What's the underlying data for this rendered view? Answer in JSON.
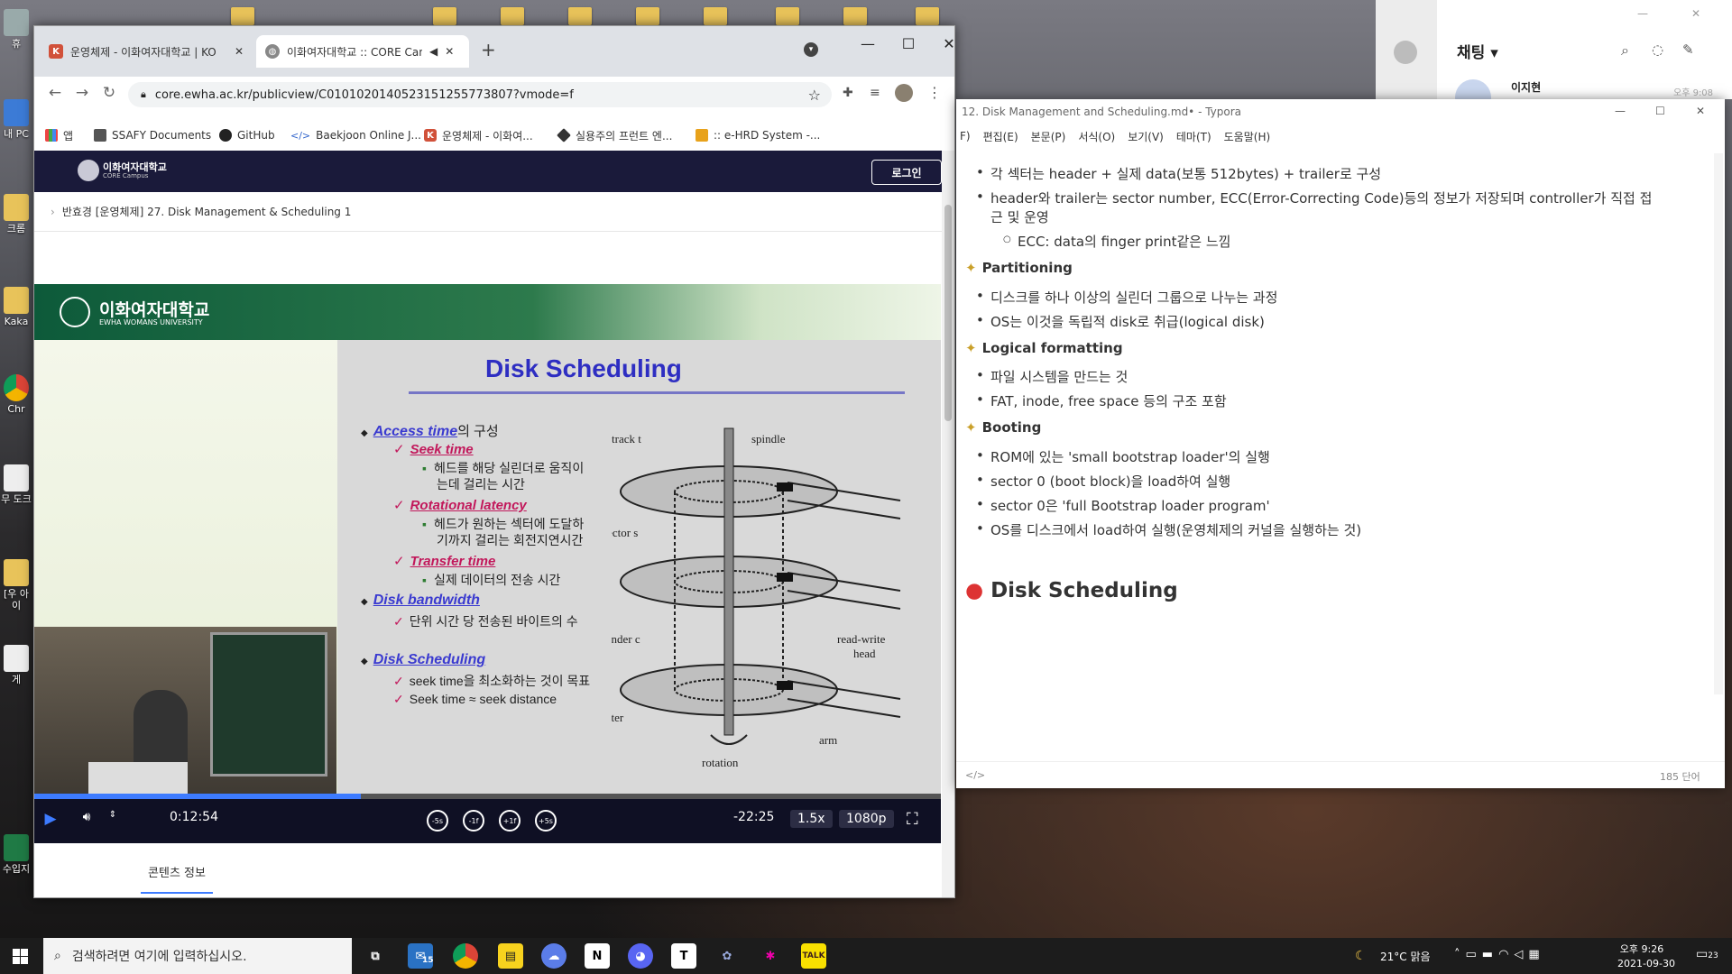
{
  "desktop": {
    "icons": [
      "휴",
      "내 PC",
      "크롬",
      "Kaka",
      "Chr",
      "무\n도크",
      "[우\n아이",
      "게",
      "수입지"
    ]
  },
  "chrome": {
    "tabs": [
      {
        "label": "운영체제 - 이화여자대학교 | KO"
      },
      {
        "label": "이화여자대학교 :: CORE Can"
      }
    ],
    "new_tab": "+",
    "url": "core.ewha.ac.kr/publicview/C0101020140523151255773807?vmode=f",
    "bookmarks": [
      "앱",
      "SSAFY Documents",
      "GitHub",
      "Baekjoon Online J...",
      "운영체제 - 이화여...",
      "실용주의 프런트 엔...",
      ":: e-HRD System -..."
    ],
    "site": {
      "brand": "이화여자대학교",
      "brand_sub": "CORE Campus",
      "login": "로그인",
      "breadcrumb": "반효경 [운영체제] 27. Disk Management & Scheduling 1",
      "content_tab": "콘텐츠 정보"
    },
    "player": {
      "time": "0:12:54",
      "remaining": "-22:25",
      "speed": "1.5x",
      "quality": "1080p",
      "progress": 0.36,
      "skips": [
        "-5s",
        "-1f",
        "+1f",
        "+5s"
      ]
    },
    "slide": {
      "univ": "이화여자대학교",
      "univ_en": "EWHA WOMANS UNIVERSITY",
      "title": "Disk Scheduling",
      "access_time": "Access time",
      "access_suffix": "의 구성",
      "seek": "Seek time",
      "seek_desc1": "헤드를 해당 실린더로 움직이",
      "seek_desc2": "는데 걸리는 시간",
      "rot": "Rotational latency",
      "rot_desc1": "헤드가 원하는 섹터에 도달하",
      "rot_desc2": "기까지 걸리는 회전지연시간",
      "transfer": "Transfer time",
      "transfer_desc": "실제 데이터의 전송 시간",
      "bandwidth": "Disk bandwidth",
      "bandwidth_desc": "단위 시간 당 전송된 바이트의 수",
      "sched": "Disk Scheduling",
      "sched_desc1": "seek time을 최소화하는 것이 목표",
      "sched_desc2": "Seek time ≈ seek distance",
      "diagram": {
        "track": "track t",
        "spindle": "spindle",
        "sector": "sector s",
        "cylinder": "cylinder c",
        "rw": "read-write",
        "head": "head",
        "platter": "platter",
        "arm": "arm",
        "rotation": "rotation"
      }
    }
  },
  "typora": {
    "title": "12. Disk Management and Scheduling.md• - Typora",
    "menu": [
      "F)",
      "편집(E)",
      "본문(P)",
      "서식(O)",
      "보기(V)",
      "테마(T)",
      "도움말(H)"
    ],
    "lines": {
      "l1": "각 섹터는 header + 실제 data(보통 512bytes) + trailer로 구성",
      "l2a": "header와 trailer는 sector number, ECC(Error-Correcting Code)등의 정보가 저장되며 controller가 직접 접",
      "l2b": "근 및 운영",
      "l3": "ECC: data의 finger print같은 느낌",
      "h_part": "Partitioning",
      "p1": "디스크를 하나 이상의 실린더 그룹으로 나누는 과정",
      "p2": "OS는 이것을 독립적 disk로 취급(logical disk)",
      "h_logic": "Logical formatting",
      "lf1": "파일 시스템을 만드는 것",
      "lf2": "FAT, inode, free space 등의 구조 포함",
      "h_boot": "Booting",
      "b1": "ROM에 있는 'small bootstrap loader'의 실행",
      "b2": "sector 0 (boot block)을 load하여 실행",
      "b3": "sector 0은 'full Bootstrap loader program'",
      "b4": "OS를 디스크에서 load하여 실행(운영체제의 커널을 실행하는 것)",
      "h2": "Disk Scheduling"
    },
    "word_count": "185 단어",
    "source_icon": "</>"
  },
  "kakao": {
    "title": "채팅 ▾",
    "contact": "이지현",
    "time": "오후 9:08"
  },
  "taskbar": {
    "search": "검색하려면 여기에 입력하십시오.",
    "weather": "21°C 맑음",
    "time": "오후 9:26",
    "date": "2021-09-30",
    "badge": "15",
    "notif": "23"
  }
}
